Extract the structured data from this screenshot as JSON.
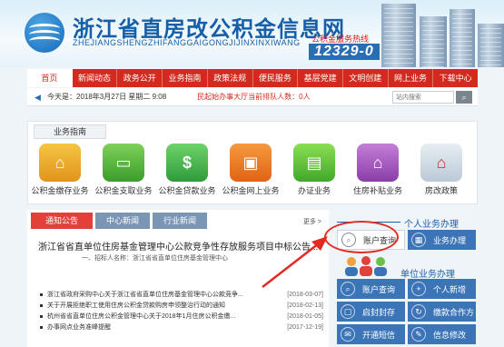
{
  "header": {
    "title": "浙江省直房改公积金信息网",
    "subtitle": "ZHEJIANGSHENGZHIFANGGAIGONGJIJINXINXIWANG",
    "hotline_label": "公积金服务热线",
    "hotline_number": "12329-0"
  },
  "nav": {
    "items": [
      {
        "label": "首页"
      },
      {
        "label": "新闻动态"
      },
      {
        "label": "政务公开"
      },
      {
        "label": "业务指南"
      },
      {
        "label": "政策法规"
      },
      {
        "label": "便民服务"
      },
      {
        "label": "基层党建"
      },
      {
        "label": "文明创建"
      },
      {
        "label": "网上业务"
      },
      {
        "label": "下载中心"
      }
    ],
    "active_index": 0
  },
  "infobar": {
    "date_text": "今天是：2018年3月27日 星期二 9:08",
    "marquee_text": "民起始办事大厅当前排队人数：0人",
    "search_placeholder": "站内搜索",
    "search_button_icon": "search-icon"
  },
  "guide": {
    "tab_label": "业务指南",
    "items": [
      {
        "label": "公积金缴存业务",
        "icon": "house-money-icon"
      },
      {
        "label": "公积金支取业务",
        "icon": "card-icon"
      },
      {
        "label": "公积金贷款业务",
        "icon": "dollar-icon"
      },
      {
        "label": "公积金网上业务",
        "icon": "computer-icon"
      },
      {
        "label": "办证业务",
        "icon": "certificate-icon"
      },
      {
        "label": "住房补贴业务",
        "icon": "subsidy-icon"
      },
      {
        "label": "房改政策",
        "icon": "house-icon"
      }
    ]
  },
  "news": {
    "tabs": [
      {
        "label": "通知公告"
      },
      {
        "label": "中心新闻"
      },
      {
        "label": "行业新闻"
      }
    ],
    "more_label": "更多 >",
    "headline": "浙江省省直单位住房基金管理中心公款竞争性存放服务项目中标公告...",
    "source": "一、招标人名称：浙江省省直单位住房基金管理中心",
    "items": [
      {
        "title": "浙江省政府采购中心关于浙江省省直单位住房基金管理中心公款竞争...",
        "date": "[2018-03-07]"
      },
      {
        "title": "关于开展拒绝职工使用住房公积金贷款购房申领整治行动的通知",
        "date": "[2018-02-13]"
      },
      {
        "title": "杭州省省直单位住房公积金管理中心关于2018年1月住房公积金缴...",
        "date": "[2018-01-05]"
      },
      {
        "title": "办事网点业务准峰提醒",
        "date": "[2017-12-19]"
      }
    ]
  },
  "personal": {
    "title": "个人业务办理",
    "query_label": "账户查询",
    "handle_label": "业务办理"
  },
  "unit": {
    "title": "单位业务办理",
    "tiles": [
      {
        "label": "账户查询",
        "icon": "search-icon"
      },
      {
        "label": "个人新增",
        "icon": "plus-icon"
      },
      {
        "label": "启封封存",
        "icon": "lock-icon"
      },
      {
        "label": "缴款合作方",
        "icon": "cycle-icon"
      },
      {
        "label": "开通短信",
        "icon": "message-icon"
      },
      {
        "label": "信息修改",
        "icon": "edit-icon"
      }
    ]
  },
  "colors": {
    "nav_red": "#d3291f",
    "brand_blue": "#155ea8",
    "tile_blue": "#3b75b8",
    "highlight_red": "#e32a20"
  }
}
